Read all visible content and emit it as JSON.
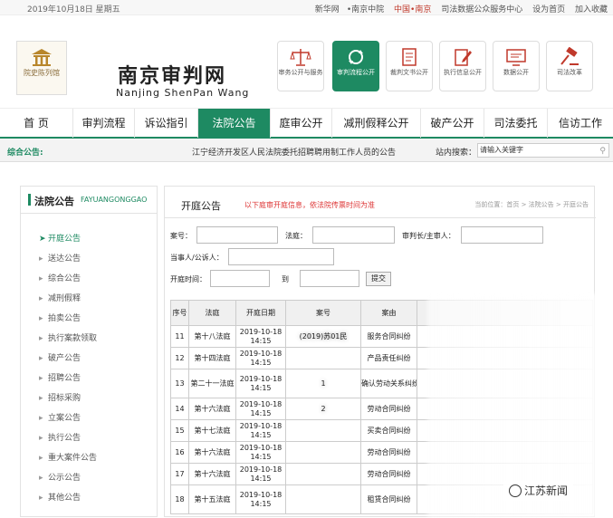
{
  "topbar": {
    "date": "2019年10月18日 星期五",
    "links": [
      "新华网",
      "南京中院",
      "中国•南京",
      "司法数据公众服务中心",
      "设为首页",
      "加入收藏"
    ]
  },
  "header": {
    "side_badge": "院史陈列馆",
    "logo_cn": "南京审判网",
    "logo_en": "Nanjing ShenPan Wang",
    "tiles": [
      {
        "label": "审务公开与服务",
        "icon": "scales-icon"
      },
      {
        "label": "审判流程公开",
        "icon": "refresh-cycle-icon",
        "active": true
      },
      {
        "label": "裁判文书公开",
        "icon": "document-icon"
      },
      {
        "label": "执行信息公开",
        "icon": "edit-document-icon"
      },
      {
        "label": "数据公开",
        "icon": "monitor-icon"
      },
      {
        "label": "司法改革",
        "icon": "gavel-icon"
      }
    ]
  },
  "nav": [
    "首 页",
    "审判流程",
    "诉讼指引",
    "法院公告",
    "庭审公开",
    "减刑假释公开",
    "破产公开",
    "司法委托",
    "信访工作"
  ],
  "nav_active": 3,
  "notice": {
    "label": "综合公告:",
    "text": "江宁经济开发区人民法院委托招聘聘用制工作人员的公告",
    "search_label": "站内搜索：",
    "search_placeholder": "请输入关键字"
  },
  "sidebar": {
    "title": "法院公告",
    "title_en": "FAYUANGONGGAO",
    "items": [
      "开庭公告",
      "送达公告",
      "综合公告",
      "减刑假释",
      "拍卖公告",
      "执行案款领取",
      "破产公告",
      "招聘公告",
      "招标采购",
      "立案公告",
      "执行公告",
      "重大案件公告",
      "公示公告",
      "其他公告"
    ],
    "active": 0
  },
  "main": {
    "title": "开庭公告",
    "note": "以下庭审开庭信息，依法院传票时间为准",
    "breadcrumb": "当前位置：首页 > 法院公告 > 开庭公告",
    "form": {
      "case_no": "案号：",
      "court": "法庭：",
      "judge": "审判长/主审人：",
      "party": "当事人/公诉人：",
      "date": "开庭时间：",
      "to": "到",
      "submit": "提交"
    },
    "table": {
      "headers": [
        "序号",
        "法庭",
        "开庭日期",
        "案号",
        "案由"
      ],
      "rows": [
        {
          "no": "11",
          "court": "第十八法庭",
          "date": "2019-10-18 14:15",
          "case": "(2019)苏01民",
          "cause": "服务合同纠纷"
        },
        {
          "no": "12",
          "court": "第十四法庭",
          "date": "2019-10-18 14:15",
          "case": "",
          "cause": "产品责任纠纷"
        },
        {
          "no": "13",
          "court": "第二十一法庭",
          "date": "2019-10-18 14:15",
          "case": "1",
          "cause": "确认劳动关系纠纷"
        },
        {
          "no": "14",
          "court": "第十六法庭",
          "date": "2019-10-18 14:15",
          "case": "2",
          "cause": "劳动合同纠纷"
        },
        {
          "no": "15",
          "court": "第十七法庭",
          "date": "2019-10-18 14:15",
          "case": "",
          "cause": "买卖合同纠纷"
        },
        {
          "no": "16",
          "court": "第十六法庭",
          "date": "2019-10-18 14:15",
          "case": "",
          "cause": "劳动合同纠纷"
        },
        {
          "no": "17",
          "court": "第十六法庭",
          "date": "2019-10-18 14:15",
          "case": "",
          "cause": "劳动合同纠纷"
        },
        {
          "no": "18",
          "court": "第十五法庭",
          "date": "2019-10-18 14:15",
          "case": "",
          "cause": "租赁合同纠纷"
        }
      ]
    }
  },
  "watermark": "江苏新闻",
  "colors": {
    "accent": "#1e8a62",
    "notice_red": "#dd3333"
  }
}
